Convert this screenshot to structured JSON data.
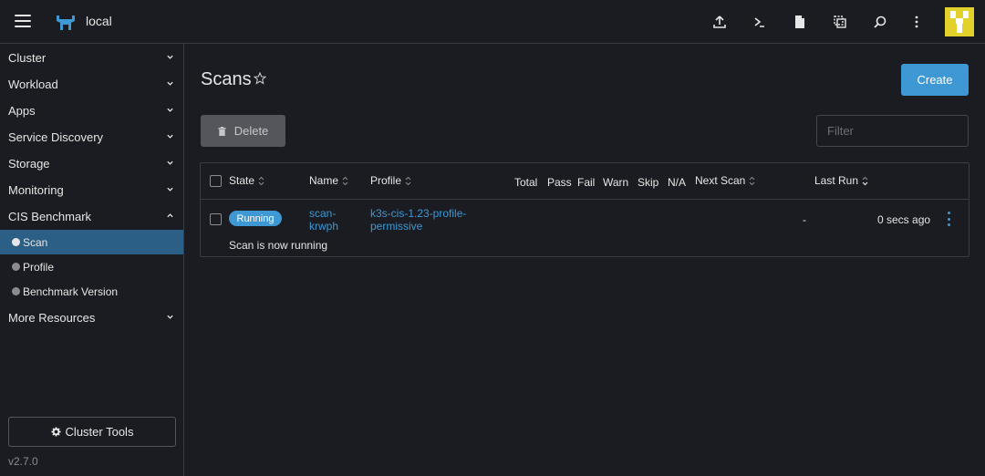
{
  "header": {
    "cluster_name": "local",
    "icons": [
      "upload-icon",
      "kubectl-shell-icon",
      "file-icon",
      "copy-kubeconfig-icon",
      "search-icon",
      "more-vertical-icon"
    ]
  },
  "sidebar": {
    "groups": [
      {
        "label": "Cluster"
      },
      {
        "label": "Workload"
      },
      {
        "label": "Apps"
      },
      {
        "label": "Service Discovery"
      },
      {
        "label": "Storage"
      },
      {
        "label": "Monitoring"
      },
      {
        "label": "CIS Benchmark"
      },
      {
        "label": "More Resources"
      }
    ],
    "cis_items": [
      {
        "label": "Scan",
        "active": true
      },
      {
        "label": "Profile",
        "active": false
      },
      {
        "label": "Benchmark Version",
        "active": false
      }
    ],
    "cluster_tools_label": "Cluster Tools",
    "version": "v2.7.0"
  },
  "main": {
    "title": "Scans",
    "create_label": "Create",
    "delete_label": "Delete",
    "filter_placeholder": "Filter",
    "columns": {
      "state": "State",
      "name": "Name",
      "profile": "Profile",
      "total": "Total",
      "pass": "Pass",
      "fail": "Fail",
      "warn": "Warn",
      "skip": "Skip",
      "na": "N/A",
      "next_scan": "Next Scan",
      "last_run": "Last Run"
    },
    "rows": [
      {
        "state": "Running",
        "name_line1": "scan-",
        "name_line2": "krwph",
        "profile_line1": "k3s-cis-1.23-profile-",
        "profile_line2": "permissive",
        "next_scan": "-",
        "last_run": "0 secs ago",
        "message": "Scan is now running"
      }
    ]
  },
  "colors": {
    "accent": "#3d98d3",
    "active_nav": "#2b5f86",
    "background": "#1b1c21",
    "avatar": "#e3d12b"
  }
}
